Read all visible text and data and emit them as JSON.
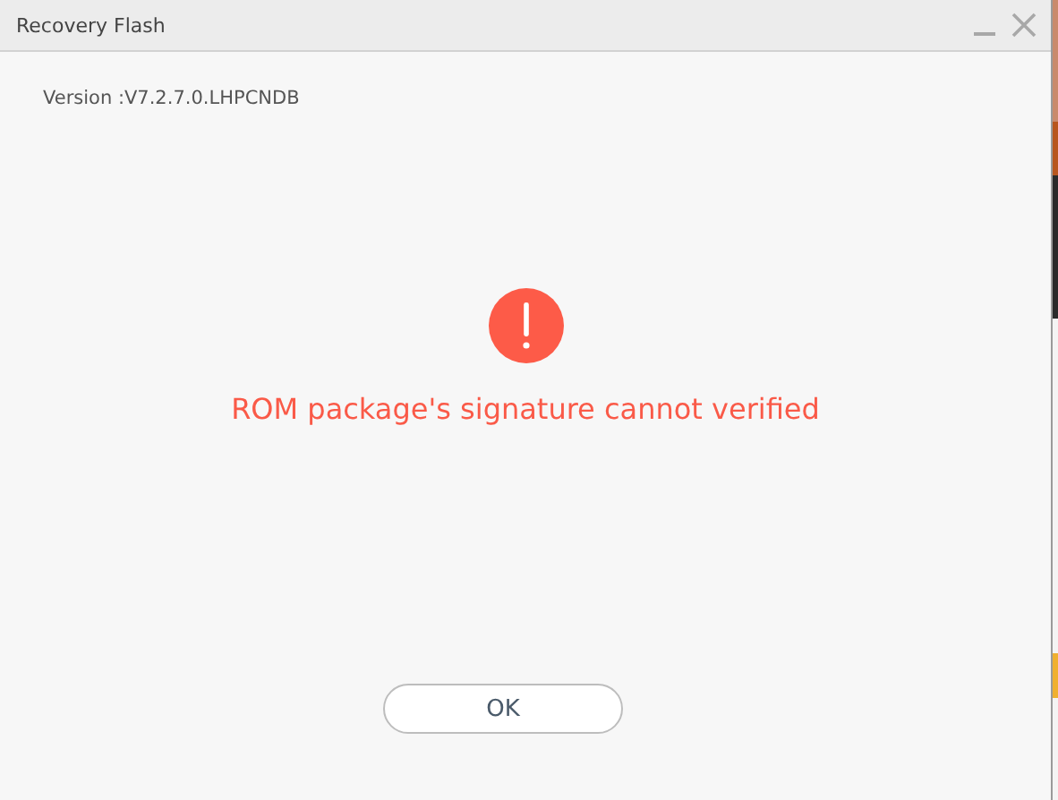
{
  "window": {
    "title": "Recovery Flash"
  },
  "version": "Version :V7.2.7.0.LHPCNDB",
  "message": "ROM package's signature cannot verified",
  "buttons": [
    "OK"
  ]
}
